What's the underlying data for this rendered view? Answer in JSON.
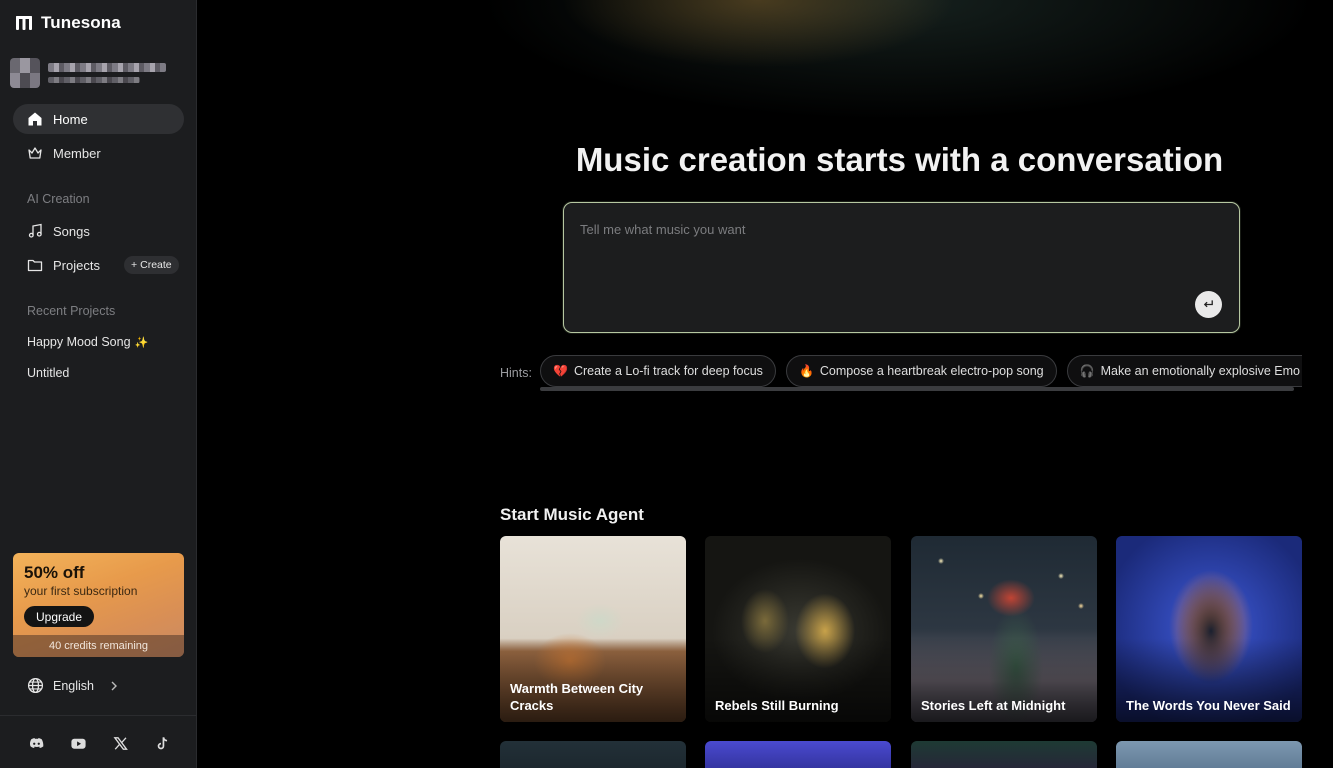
{
  "app": {
    "name": "Tunesona"
  },
  "sidebar": {
    "nav": [
      {
        "label": "Home",
        "icon": "home-icon",
        "active": true
      },
      {
        "label": "Member",
        "icon": "crown-icon",
        "active": false
      }
    ],
    "ai_creation": {
      "heading": "AI Creation",
      "items": [
        {
          "label": "Songs",
          "icon": "music-note-icon"
        },
        {
          "label": "Projects",
          "icon": "folder-icon"
        }
      ],
      "create_label": "Create"
    },
    "recent": {
      "heading": "Recent Projects",
      "items": [
        {
          "label": "Happy Mood Song",
          "badge": "✨"
        },
        {
          "label": "Untitled"
        }
      ]
    },
    "promo": {
      "title": "50% off",
      "subtitle": "your first subscription",
      "button": "Upgrade",
      "credits": "40 credits remaining"
    },
    "language": "English",
    "socials": [
      "discord-icon",
      "youtube-icon",
      "x-icon",
      "tiktok-icon"
    ]
  },
  "main": {
    "title": "Music creation starts with a conversation",
    "prompt": {
      "placeholder": "Tell me what music you want"
    },
    "hints": {
      "label": "Hints:",
      "items": [
        {
          "icon": "💔",
          "text": "Create a Lo-fi track for deep focus"
        },
        {
          "icon": "🔥",
          "text": "Compose a heartbreak electro-pop song"
        },
        {
          "icon": "🎧",
          "text": "Make an emotionally explosive Emo Rock track"
        }
      ]
    },
    "agent": {
      "title": "Start Music Agent",
      "cards": [
        {
          "title": "Warmth Between City Cracks"
        },
        {
          "title": "Rebels Still Burning"
        },
        {
          "title": "Stories Left at Midnight"
        },
        {
          "title": "The Words You Never Said"
        }
      ]
    }
  }
}
